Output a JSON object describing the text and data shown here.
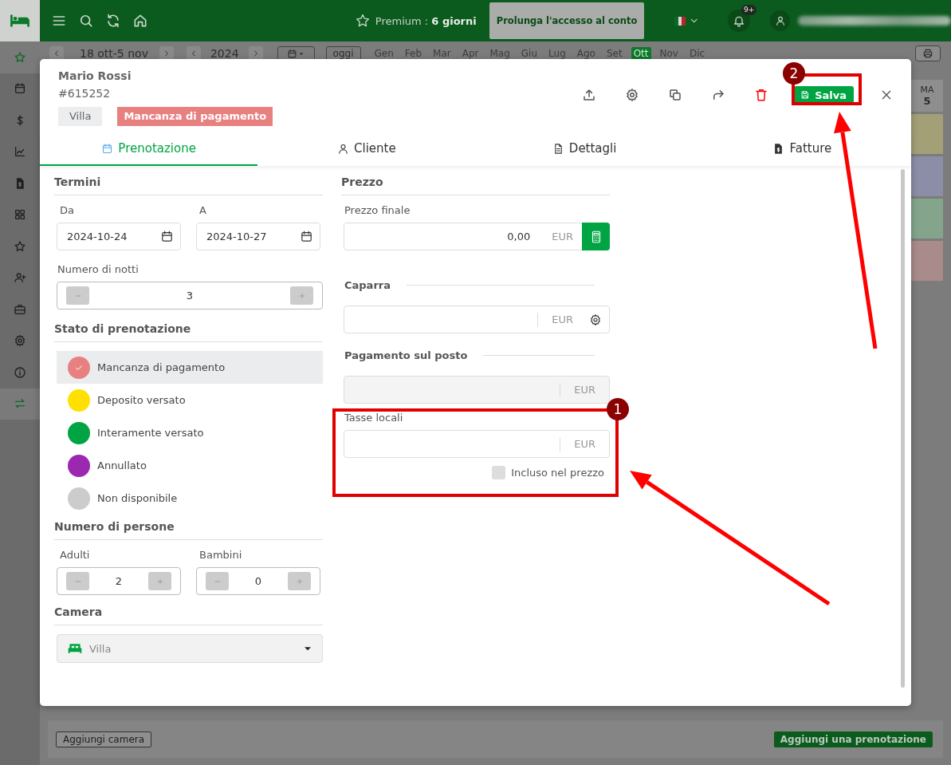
{
  "app_header": {
    "premium_label": "Premium :",
    "premium_days": "6 giorni",
    "extend_button": "Prolunga l'accesso al conto",
    "notifications_badge": "9+"
  },
  "sidebar": {
    "items": [
      {
        "selected": true
      },
      {
        "selected": false
      },
      {
        "selected": false
      },
      {
        "selected": false
      },
      {
        "selected": false
      },
      {
        "selected": false
      },
      {
        "selected": false
      },
      {
        "selected": false
      },
      {
        "selected": false
      },
      {
        "selected": false
      },
      {
        "selected": false
      },
      {
        "selected": true
      }
    ]
  },
  "calendar_toolbar": {
    "date_range": "18 ott-5 nov",
    "year": "2024",
    "today_button": "oggi",
    "months": [
      {
        "label": "Gen",
        "selected": false
      },
      {
        "label": "Feb",
        "selected": false
      },
      {
        "label": "Mar",
        "selected": false
      },
      {
        "label": "Apr",
        "selected": false
      },
      {
        "label": "Mag",
        "selected": false
      },
      {
        "label": "Giu",
        "selected": false
      },
      {
        "label": "Lug",
        "selected": false
      },
      {
        "label": "Ago",
        "selected": false
      },
      {
        "label": "Set",
        "selected": false
      },
      {
        "label": "Ott",
        "selected": true
      },
      {
        "label": "Nov",
        "selected": false
      },
      {
        "label": "Dic",
        "selected": false
      }
    ]
  },
  "calendar": {
    "day_header": {
      "weekday": "MA",
      "day": "5"
    },
    "bookings": [
      {
        "color": "#a3a077"
      },
      {
        "color": "#8b8ea6"
      },
      {
        "color": "#84a58c"
      },
      {
        "color": "#a98b8b"
      }
    ]
  },
  "footer": {
    "add_room_button": "Aggiungi camera",
    "add_booking_button": "Aggiungi una prenotazione"
  },
  "dialog": {
    "guest_name": "Mario Rossi",
    "booking_id": "#615252",
    "tags": [
      {
        "label": "Villa",
        "kind": "room"
      },
      {
        "label": "Mancanza di pagamento",
        "kind": "status"
      }
    ],
    "save_button": "Salva",
    "tabs": [
      {
        "label": "Prenotazione",
        "selected": true
      },
      {
        "label": "Cliente",
        "selected": false
      },
      {
        "label": "Dettagli",
        "selected": false
      },
      {
        "label": "Fatture",
        "selected": false
      }
    ],
    "terms": {
      "title": "Termini",
      "from": {
        "label": "Da",
        "value": "2024-10-24"
      },
      "to": {
        "label": "A",
        "value": "2024-10-27"
      },
      "nights": {
        "label": "Numero di notti",
        "value": "3"
      }
    },
    "booking_status": {
      "title": "Stato di prenotazione",
      "options": [
        {
          "label": "Mancanza di pagamento",
          "color": "#e88080",
          "selected": true
        },
        {
          "label": "Deposito versato",
          "color": "#ffe000",
          "selected": false
        },
        {
          "label": "Interamente versato",
          "color": "#00a443",
          "selected": false
        },
        {
          "label": "Annullato",
          "color": "#9c27b0",
          "selected": false
        },
        {
          "label": "Non disponibile",
          "color": "#cccccc",
          "selected": false
        }
      ]
    },
    "guests": {
      "title": "Numero di persone",
      "adults": {
        "label": "Adulti",
        "value": "2"
      },
      "children": {
        "label": "Bambini",
        "value": "0"
      }
    },
    "room": {
      "title": "Camera",
      "value": "Villa"
    },
    "price": {
      "title": "Prezzo",
      "final_price": {
        "label": "Prezzo finale",
        "value": "0,00",
        "currency": "EUR"
      },
      "deposit": {
        "label": "Caparra",
        "currency": "EUR"
      },
      "on_site_payment": {
        "label": "Pagamento sul posto",
        "currency": "EUR",
        "disabled": true
      },
      "local_taxes": {
        "label": "Tasse locali",
        "currency": "EUR"
      },
      "included_in_price": {
        "label": "Incluso nel prezzo",
        "checked": false
      }
    }
  },
  "annotations": [
    {
      "number": "1"
    },
    {
      "number": "2"
    }
  ]
}
